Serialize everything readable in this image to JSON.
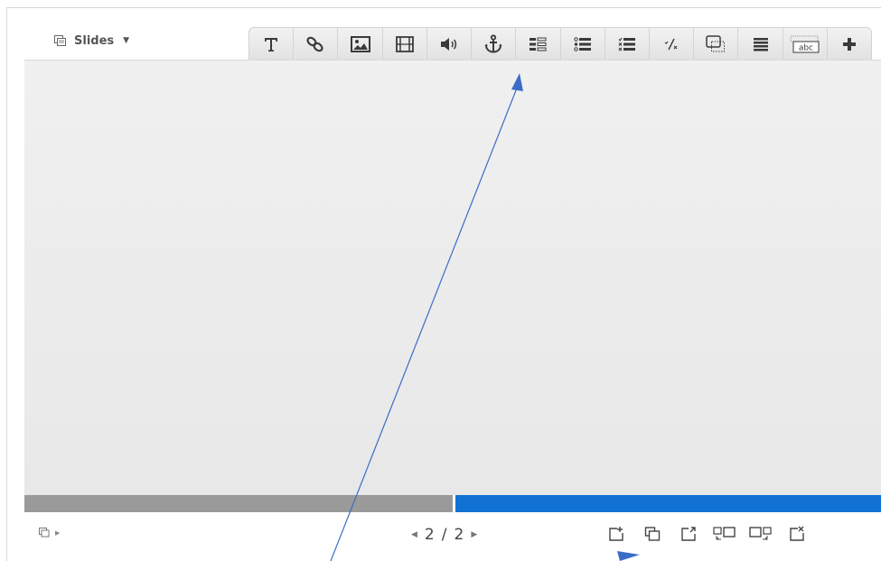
{
  "header": {
    "slides_label": "Slides",
    "slides_icon": "slides-icon"
  },
  "toolbar": {
    "buttons": [
      {
        "name": "text-button",
        "icon": "text-icon"
      },
      {
        "name": "link-button",
        "icon": "link-icon"
      },
      {
        "name": "image-button",
        "icon": "image-icon"
      },
      {
        "name": "video-button",
        "icon": "film-icon"
      },
      {
        "name": "audio-button",
        "icon": "speaker-icon"
      },
      {
        "name": "anchor-button",
        "icon": "anchor-icon"
      },
      {
        "name": "form-fields-button",
        "icon": "form-fields-icon"
      },
      {
        "name": "radio-list-button",
        "icon": "radio-list-icon"
      },
      {
        "name": "checkbox-list-button",
        "icon": "checkbox-list-icon"
      },
      {
        "name": "fill-blank-button",
        "icon": "fraction-icon"
      },
      {
        "name": "hotspot-button",
        "icon": "hotspot-icon"
      },
      {
        "name": "list-button",
        "icon": "list-icon"
      },
      {
        "name": "text-input-button",
        "icon": "text-input-icon"
      },
      {
        "name": "more-button",
        "icon": "plus-icon"
      }
    ],
    "abc_label": "abc"
  },
  "progress": {
    "current_fraction": 0.5
  },
  "pager": {
    "current": "2",
    "separator": "/",
    "total": "2"
  },
  "bottom_toolbar": {
    "icons": [
      "add-slide-icon",
      "clone-slide-icon",
      "import-slide-icon",
      "move-slide-left-icon",
      "move-slide-right-icon",
      "delete-slide-icon"
    ]
  },
  "colors": {
    "accent": "#1172d4",
    "progress_track": "#9a9a9a",
    "annotation": "#3b6cc6"
  }
}
